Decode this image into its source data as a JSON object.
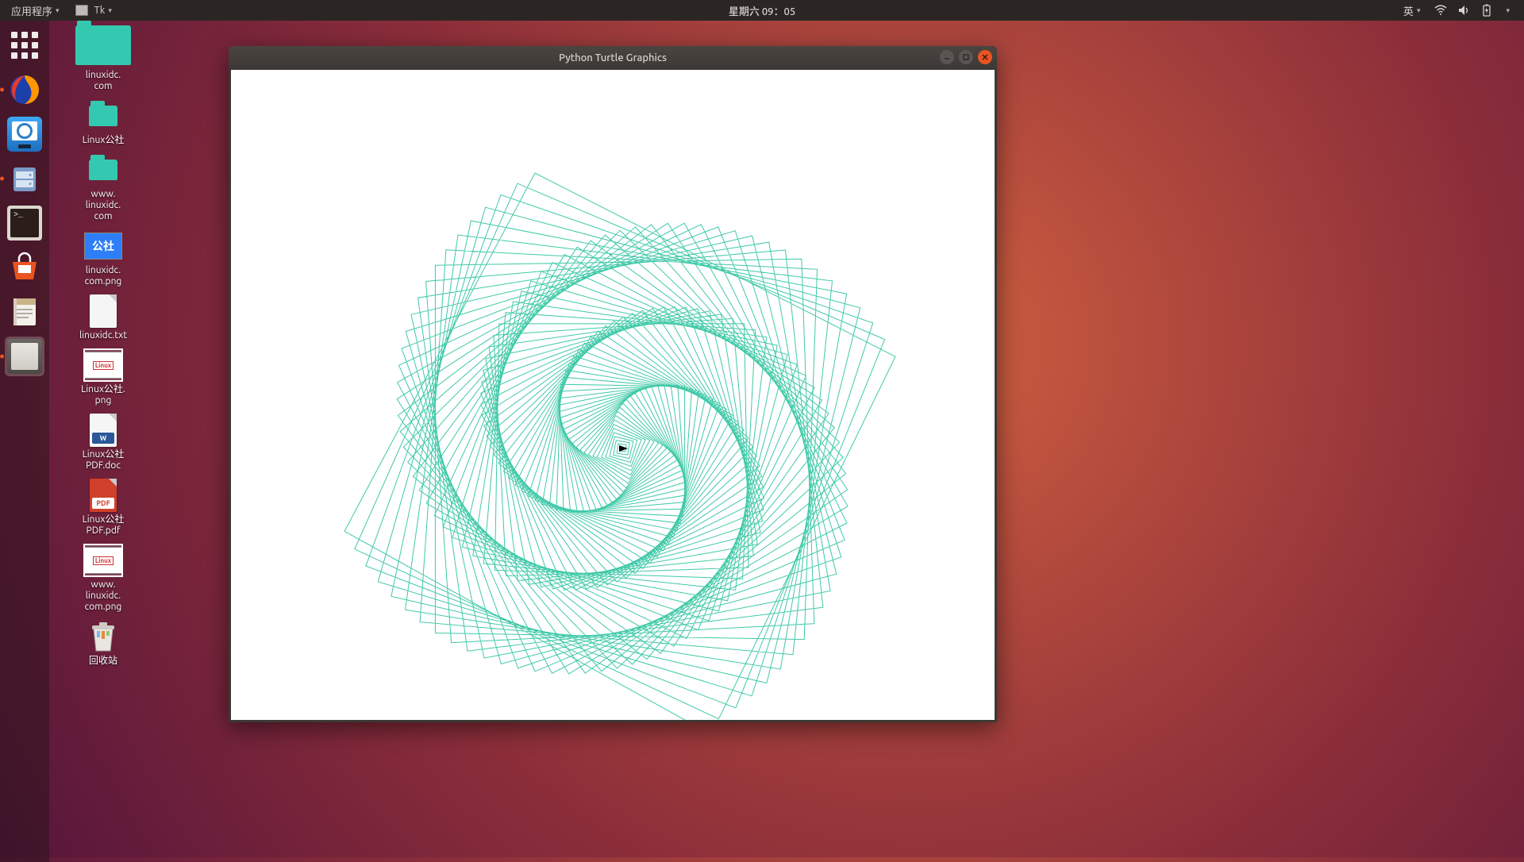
{
  "top_panel": {
    "applications_label": "应用程序",
    "tk_label": "Tk",
    "clock": "星期六 09：05",
    "input_method": "英"
  },
  "desktop_icons": [
    {
      "type": "folder",
      "label": "linuxidc.\ncom"
    },
    {
      "type": "folder",
      "label": "Linux公社"
    },
    {
      "type": "folder",
      "label": "www.\nlinuxidc.\ncom"
    },
    {
      "type": "image",
      "label": "linuxidc.\ncom.png",
      "thumb_text": "公社",
      "thumb_bg": "#2d7ef7"
    },
    {
      "type": "text",
      "label": "linuxidc.txt"
    },
    {
      "type": "image",
      "label": "Linux公社.\npng",
      "thumb_text": "Linux",
      "thumb_bg": "#ffffff",
      "selected": true
    },
    {
      "type": "doc",
      "label": "Linux公社\nPDF.doc",
      "tag": "W",
      "tag_bg": "#2b579a"
    },
    {
      "type": "pdf",
      "label": "Linux公社\nPDF.pdf",
      "tag": "PDF",
      "tag_bg": "#d0402a"
    },
    {
      "type": "image",
      "label": "www.\nlinuxidc.\ncom.png",
      "thumb_text": "Linux",
      "thumb_bg": "#ffffff",
      "selected": true
    },
    {
      "type": "trash",
      "label": "回收站"
    }
  ],
  "window": {
    "title": "Python Turtle Graphics"
  },
  "turtle": {
    "pen_color": "#3fc9a8",
    "iterations": 300,
    "step_growth": 1,
    "turn_angle_deg": 89
  }
}
